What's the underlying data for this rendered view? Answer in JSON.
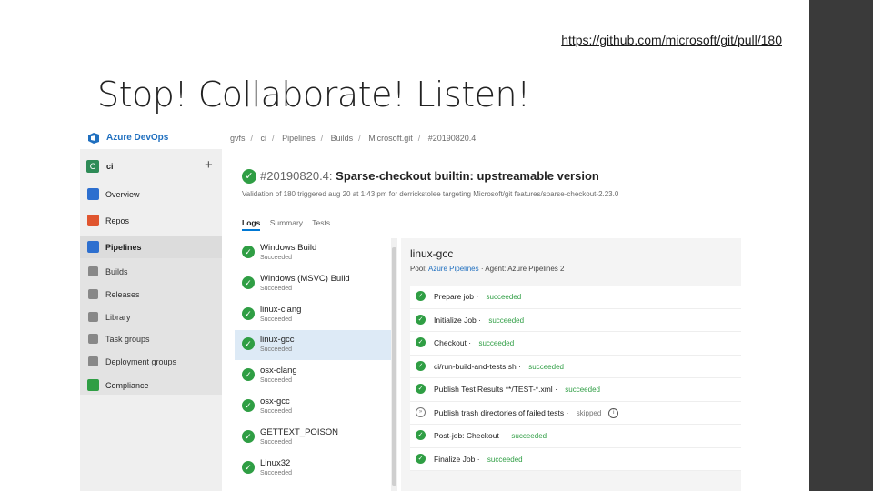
{
  "slide": {
    "link": "https://github.com/microsoft/git/pull/180",
    "title": "Stop! Collaborate! Listen!"
  },
  "app": {
    "brand": "Azure DevOps",
    "breadcrumb": [
      "gvfs",
      "ci",
      "Pipelines",
      "Builds",
      "Microsoft.git",
      "#20190820.4"
    ]
  },
  "sidebar": {
    "project_badge": "C",
    "project_name": "ci",
    "add_label": "+",
    "items": [
      {
        "label": "Overview",
        "icon": "overview-icon",
        "color": "#2d6fcf"
      },
      {
        "label": "Repos",
        "icon": "repos-icon",
        "color": "#e0552f"
      },
      {
        "label": "Pipelines",
        "icon": "pipelines-icon",
        "color": "#2d6fcf"
      },
      {
        "label": "Builds",
        "icon": "builds-icon"
      },
      {
        "label": "Releases",
        "icon": "releases-icon"
      },
      {
        "label": "Library",
        "icon": "library-icon"
      },
      {
        "label": "Task groups",
        "icon": "task-groups-icon"
      },
      {
        "label": "Deployment groups",
        "icon": "deployment-groups-icon"
      },
      {
        "label": "Compliance",
        "icon": "compliance-icon",
        "color": "#2f9e44"
      }
    ]
  },
  "run": {
    "number": "#20190820.4:",
    "title": "Sparse-checkout builtin: upstreamable version",
    "meta": "Validation of  180 triggered aug 20 at 1:43 pm for derrickstolee targeting  Microsoft/git  features/sparse-checkout-2.23.0",
    "tabs": [
      "Logs",
      "Summary",
      "Tests"
    ]
  },
  "jobs": [
    {
      "name": "Windows Build",
      "status": "Succeeded"
    },
    {
      "name": "Windows (MSVC) Build",
      "status": "Succeeded"
    },
    {
      "name": "linux-clang",
      "status": "Succeeded"
    },
    {
      "name": "linux-gcc",
      "status": "Succeeded"
    },
    {
      "name": "osx-clang",
      "status": "Succeeded"
    },
    {
      "name": "osx-gcc",
      "status": "Succeeded"
    },
    {
      "name": "GETTEXT_POISON",
      "status": "Succeeded"
    },
    {
      "name": "Linux32",
      "status": "Succeeded"
    }
  ],
  "detail": {
    "title": "linux-gcc",
    "pool_label": "Pool: ",
    "pool_value": "Azure Pipelines",
    "agent": " · Agent: Azure Pipelines 2",
    "steps": [
      {
        "name": "Prepare job",
        "status": "succeeded"
      },
      {
        "name": "Initialize Job",
        "status": "succeeded"
      },
      {
        "name": "Checkout",
        "status": "succeeded"
      },
      {
        "name": "ci/run-build-and-tests.sh",
        "status": "succeeded"
      },
      {
        "name": "Publish Test Results **/TEST-*.xml",
        "status": "succeeded"
      },
      {
        "name": "Publish trash directories of failed tests",
        "status": "skipped"
      },
      {
        "name": "Post-job: Checkout",
        "status": "succeeded"
      },
      {
        "name": "Finalize Job",
        "status": "succeeded"
      }
    ]
  },
  "colors": {
    "accent": "#0078d4",
    "success": "#2f9e44",
    "sidebar_bg": "#efefef",
    "slide_bar": "#3a3a3a"
  }
}
